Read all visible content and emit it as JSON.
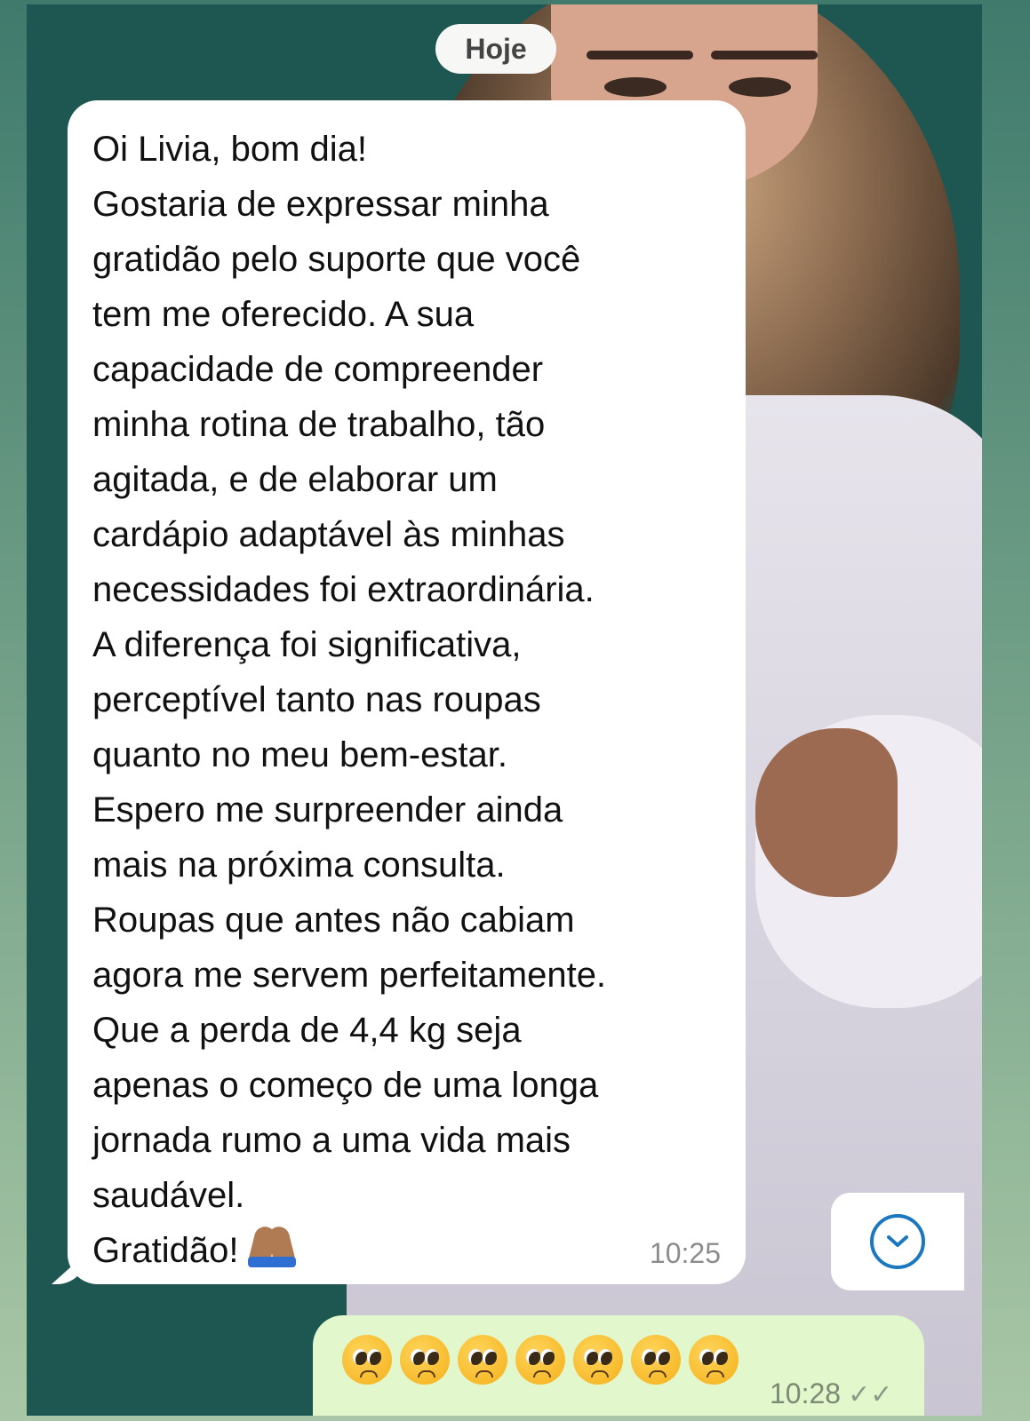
{
  "date_divider": "Hoje",
  "incoming_message": {
    "lines": [
      "Oi Livia, bom dia!",
      "Gostaria de expressar minha",
      "gratidão pelo suporte que você",
      "tem me oferecido. A sua",
      "capacidade de compreender",
      "minha rotina de trabalho, tão",
      "agitada, e de elaborar um",
      "cardápio adaptável às minhas",
      "necessidades foi extraordinária.",
      "A diferença foi significativa,",
      "perceptível tanto nas roupas",
      "quanto no meu bem-estar.",
      "Espero me surpreender ainda",
      "mais na próxima consulta.",
      "Roupas que antes não cabiam",
      "agora me servem perfeitamente.",
      "Que a perda de 4,4 kg seja",
      "apenas o começo de uma longa",
      "jornada rumo a uma vida mais",
      "saudável.",
      "Gratidão!"
    ],
    "emoji_icon": "folded-hands-icon",
    "time": "10:25"
  },
  "scroll_down_icon": "chevron-down-icon",
  "outgoing_message": {
    "emoji_icon": "pleading-face-icon",
    "emoji_count": 7,
    "time": "10:28",
    "status_icon": "double-check-icon"
  },
  "colors": {
    "incoming_bubble": "#ffffff",
    "outgoing_bubble": "#e2f7cb",
    "accent": "#1b78be",
    "background": "#1e5751"
  }
}
